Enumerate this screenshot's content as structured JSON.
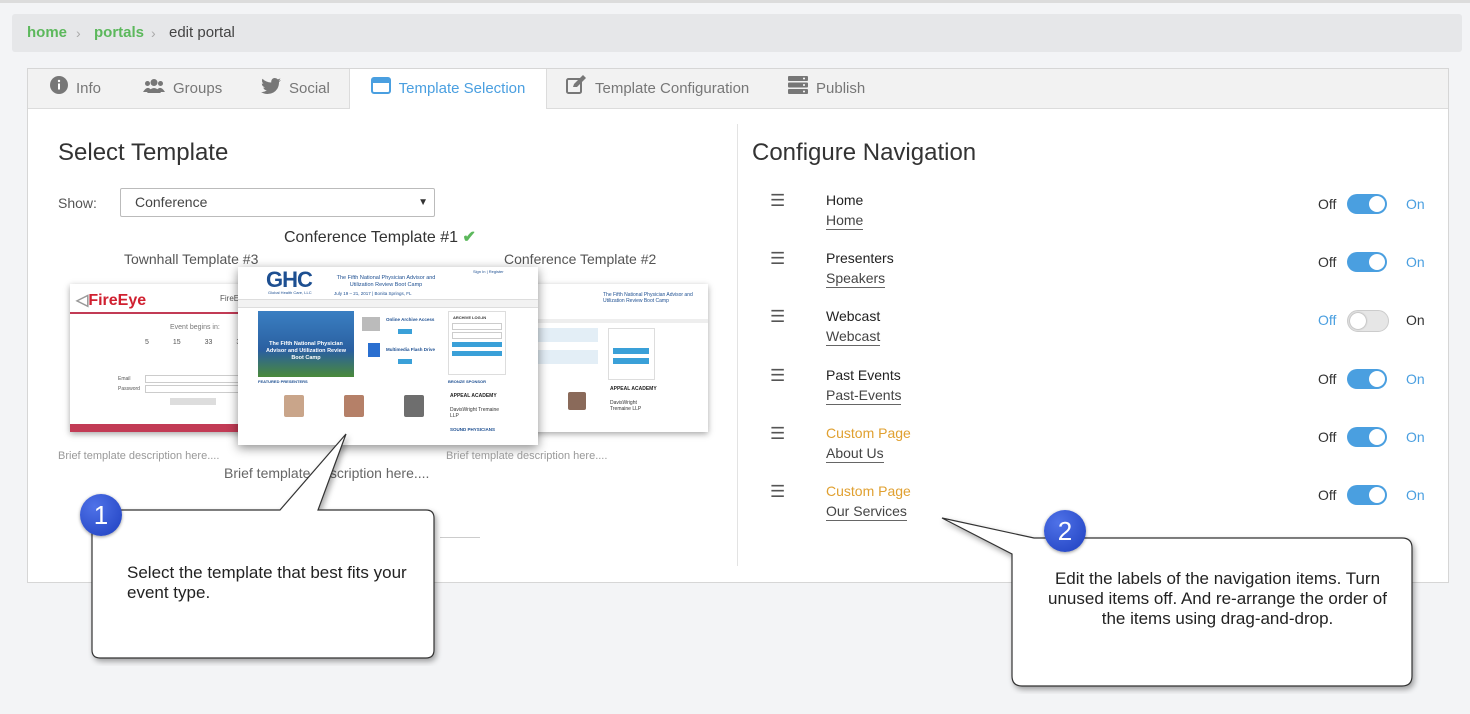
{
  "breadcrumb": {
    "home": "home",
    "portals": "portals",
    "current": "edit portal"
  },
  "tabs": [
    {
      "label": "Info",
      "icon": "info-circle-icon"
    },
    {
      "label": "Groups",
      "icon": "users-icon"
    },
    {
      "label": "Social",
      "icon": "twitter-icon"
    },
    {
      "label": "Template Selection",
      "icon": "window-icon"
    },
    {
      "label": "Template Configuration",
      "icon": "edit-icon"
    },
    {
      "label": "Publish",
      "icon": "server-icon"
    }
  ],
  "select_template": {
    "title": "Select Template",
    "show_label": "Show:",
    "show_value": "Conference",
    "templates": [
      {
        "name": "Townhall Template #3",
        "desc": "Brief template description here...."
      },
      {
        "name": "Conference Template #1",
        "desc": "Brief template description here...."
      },
      {
        "name": "Conference Template #2",
        "desc": "Brief template description here...."
      }
    ],
    "thumbs": {
      "fireeye_logo": "FireEye",
      "fireeye_right": "FireEye",
      "event_begins": "Event begins in:",
      "countdown": [
        "5",
        "15",
        "33",
        "33"
      ],
      "email": "Email",
      "password": "Password",
      "ghc_logo": "GHC",
      "ghc_sub": "Global Health Care, LLC",
      "conf_title": "The Fifth National Physician Advisor and Utilization Review Boot Camp",
      "conf_date": "July 19 – 21, 2017 | Bonita Springs, FL",
      "sign_in": "Sign In | Register",
      "hero_text": "The Fifth National Physician Advisor and Utilization Review Boot Camp",
      "archive": "ARCHIVE LOG-IN",
      "online_archive": "Online Archive Access",
      "flash_drive": "Multimedia Flash Drive",
      "featured": "FEATURED PRESENTERS",
      "bronze": "BRONZE SPONSOR",
      "appeal": "APPEAL ACADEMY",
      "davis": "DavisWright Tremaine LLP",
      "sound": "SOUND PHYSICIANS"
    }
  },
  "configure_nav": {
    "title": "Configure Navigation",
    "off_label": "Off",
    "on_label": "On",
    "items": [
      {
        "type": "Home",
        "label": "Home",
        "on": true,
        "custom": false
      },
      {
        "type": "Presenters",
        "label": "Speakers",
        "on": true,
        "custom": false
      },
      {
        "type": "Webcast",
        "label": "Webcast",
        "on": false,
        "custom": false
      },
      {
        "type": "Past Events",
        "label": "Past-Events",
        "on": true,
        "custom": false
      },
      {
        "type": "Custom Page",
        "label": "About Us",
        "on": true,
        "custom": true
      },
      {
        "type": "Custom Page",
        "label": "Our Services",
        "on": true,
        "custom": true
      }
    ]
  },
  "callouts": [
    {
      "num": "1",
      "text": "Select the template that best fits your event type."
    },
    {
      "num": "2",
      "text": "Edit the labels of the navigation items. Turn unused items off. And re-arrange the order of the items using drag-and-drop."
    }
  ],
  "colors": {
    "accent": "#4a9fe0",
    "green": "#5cb85c",
    "custom": "#e0a030",
    "toggle_on": "#4a9fe0",
    "toggle_off": "#e6e6e6"
  }
}
